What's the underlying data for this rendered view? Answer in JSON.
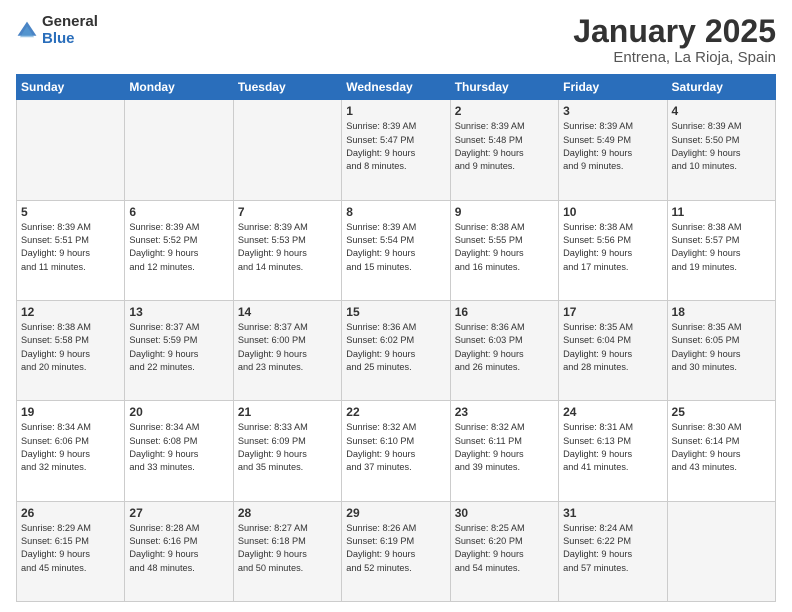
{
  "logo": {
    "general": "General",
    "blue": "Blue"
  },
  "header": {
    "month": "January 2025",
    "location": "Entrena, La Rioja, Spain"
  },
  "weekdays": [
    "Sunday",
    "Monday",
    "Tuesday",
    "Wednesday",
    "Thursday",
    "Friday",
    "Saturday"
  ],
  "weeks": [
    [
      {
        "day": "",
        "info": ""
      },
      {
        "day": "",
        "info": ""
      },
      {
        "day": "",
        "info": ""
      },
      {
        "day": "1",
        "info": "Sunrise: 8:39 AM\nSunset: 5:47 PM\nDaylight: 9 hours\nand 8 minutes."
      },
      {
        "day": "2",
        "info": "Sunrise: 8:39 AM\nSunset: 5:48 PM\nDaylight: 9 hours\nand 9 minutes."
      },
      {
        "day": "3",
        "info": "Sunrise: 8:39 AM\nSunset: 5:49 PM\nDaylight: 9 hours\nand 9 minutes."
      },
      {
        "day": "4",
        "info": "Sunrise: 8:39 AM\nSunset: 5:50 PM\nDaylight: 9 hours\nand 10 minutes."
      }
    ],
    [
      {
        "day": "5",
        "info": "Sunrise: 8:39 AM\nSunset: 5:51 PM\nDaylight: 9 hours\nand 11 minutes."
      },
      {
        "day": "6",
        "info": "Sunrise: 8:39 AM\nSunset: 5:52 PM\nDaylight: 9 hours\nand 12 minutes."
      },
      {
        "day": "7",
        "info": "Sunrise: 8:39 AM\nSunset: 5:53 PM\nDaylight: 9 hours\nand 14 minutes."
      },
      {
        "day": "8",
        "info": "Sunrise: 8:39 AM\nSunset: 5:54 PM\nDaylight: 9 hours\nand 15 minutes."
      },
      {
        "day": "9",
        "info": "Sunrise: 8:38 AM\nSunset: 5:55 PM\nDaylight: 9 hours\nand 16 minutes."
      },
      {
        "day": "10",
        "info": "Sunrise: 8:38 AM\nSunset: 5:56 PM\nDaylight: 9 hours\nand 17 minutes."
      },
      {
        "day": "11",
        "info": "Sunrise: 8:38 AM\nSunset: 5:57 PM\nDaylight: 9 hours\nand 19 minutes."
      }
    ],
    [
      {
        "day": "12",
        "info": "Sunrise: 8:38 AM\nSunset: 5:58 PM\nDaylight: 9 hours\nand 20 minutes."
      },
      {
        "day": "13",
        "info": "Sunrise: 8:37 AM\nSunset: 5:59 PM\nDaylight: 9 hours\nand 22 minutes."
      },
      {
        "day": "14",
        "info": "Sunrise: 8:37 AM\nSunset: 6:00 PM\nDaylight: 9 hours\nand 23 minutes."
      },
      {
        "day": "15",
        "info": "Sunrise: 8:36 AM\nSunset: 6:02 PM\nDaylight: 9 hours\nand 25 minutes."
      },
      {
        "day": "16",
        "info": "Sunrise: 8:36 AM\nSunset: 6:03 PM\nDaylight: 9 hours\nand 26 minutes."
      },
      {
        "day": "17",
        "info": "Sunrise: 8:35 AM\nSunset: 6:04 PM\nDaylight: 9 hours\nand 28 minutes."
      },
      {
        "day": "18",
        "info": "Sunrise: 8:35 AM\nSunset: 6:05 PM\nDaylight: 9 hours\nand 30 minutes."
      }
    ],
    [
      {
        "day": "19",
        "info": "Sunrise: 8:34 AM\nSunset: 6:06 PM\nDaylight: 9 hours\nand 32 minutes."
      },
      {
        "day": "20",
        "info": "Sunrise: 8:34 AM\nSunset: 6:08 PM\nDaylight: 9 hours\nand 33 minutes."
      },
      {
        "day": "21",
        "info": "Sunrise: 8:33 AM\nSunset: 6:09 PM\nDaylight: 9 hours\nand 35 minutes."
      },
      {
        "day": "22",
        "info": "Sunrise: 8:32 AM\nSunset: 6:10 PM\nDaylight: 9 hours\nand 37 minutes."
      },
      {
        "day": "23",
        "info": "Sunrise: 8:32 AM\nSunset: 6:11 PM\nDaylight: 9 hours\nand 39 minutes."
      },
      {
        "day": "24",
        "info": "Sunrise: 8:31 AM\nSunset: 6:13 PM\nDaylight: 9 hours\nand 41 minutes."
      },
      {
        "day": "25",
        "info": "Sunrise: 8:30 AM\nSunset: 6:14 PM\nDaylight: 9 hours\nand 43 minutes."
      }
    ],
    [
      {
        "day": "26",
        "info": "Sunrise: 8:29 AM\nSunset: 6:15 PM\nDaylight: 9 hours\nand 45 minutes."
      },
      {
        "day": "27",
        "info": "Sunrise: 8:28 AM\nSunset: 6:16 PM\nDaylight: 9 hours\nand 48 minutes."
      },
      {
        "day": "28",
        "info": "Sunrise: 8:27 AM\nSunset: 6:18 PM\nDaylight: 9 hours\nand 50 minutes."
      },
      {
        "day": "29",
        "info": "Sunrise: 8:26 AM\nSunset: 6:19 PM\nDaylight: 9 hours\nand 52 minutes."
      },
      {
        "day": "30",
        "info": "Sunrise: 8:25 AM\nSunset: 6:20 PM\nDaylight: 9 hours\nand 54 minutes."
      },
      {
        "day": "31",
        "info": "Sunrise: 8:24 AM\nSunset: 6:22 PM\nDaylight: 9 hours\nand 57 minutes."
      },
      {
        "day": "",
        "info": ""
      }
    ]
  ]
}
